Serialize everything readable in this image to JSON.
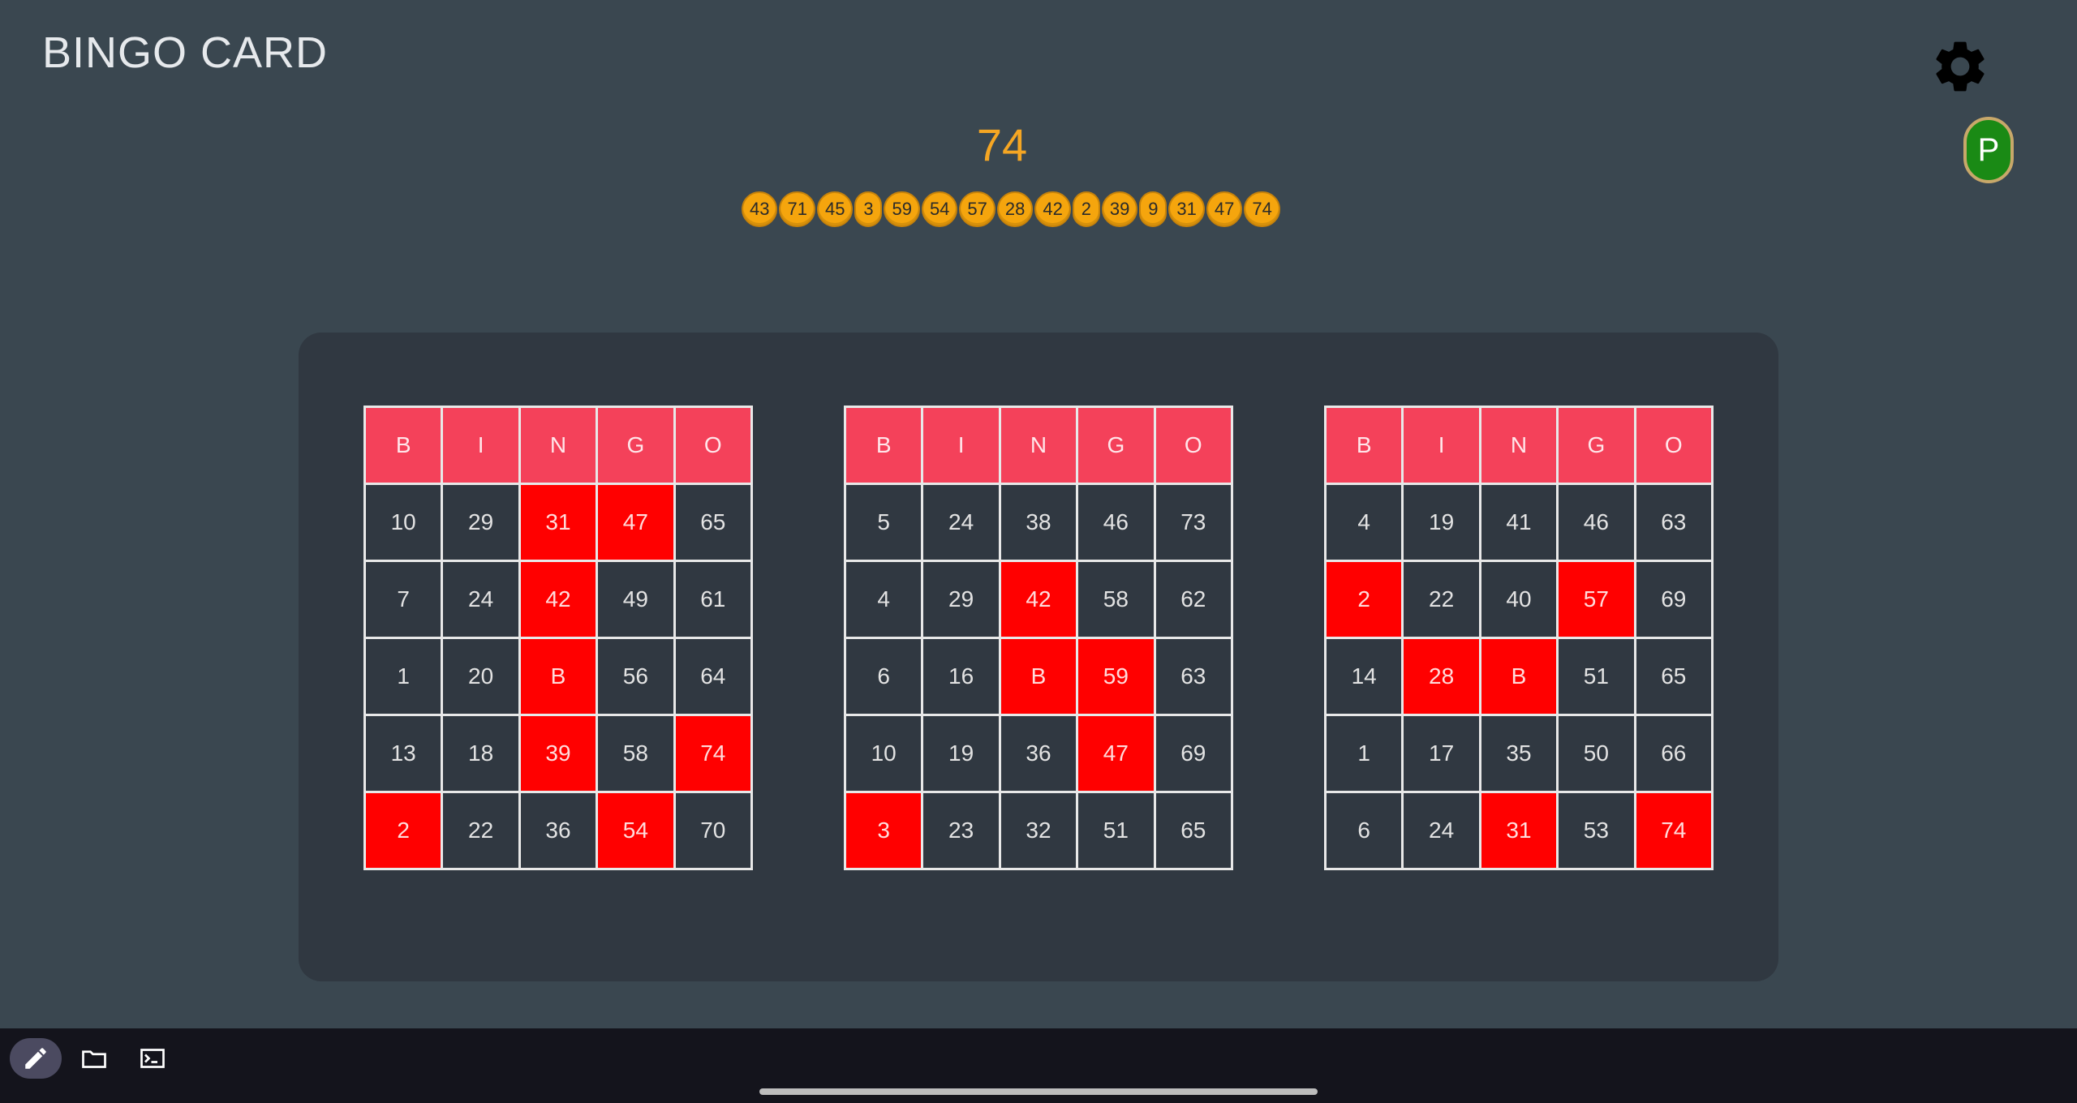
{
  "app": {
    "title": "BINGO CARD",
    "player_initial": "P",
    "current_number": "74",
    "called_numbers": [
      "43",
      "71",
      "45",
      "3",
      "59",
      "54",
      "57",
      "28",
      "42",
      "2",
      "39",
      "9",
      "31",
      "47",
      "74"
    ]
  },
  "colors": {
    "background": "#3a4750",
    "panel": "#303841",
    "header": "#f4415a",
    "marked": "#ff0000",
    "current_number": "#f5a623",
    "ball": "#f5a50d",
    "player_badge": "#1a8a15"
  },
  "icons": {
    "settings": "gear-icon",
    "edit": "pencil-icon",
    "files": "folder-icon",
    "terminal": "terminal-icon"
  },
  "cards": [
    {
      "header": [
        "B",
        "I",
        "N",
        "G",
        "O"
      ],
      "rows": [
        [
          {
            "v": "10",
            "m": false
          },
          {
            "v": "29",
            "m": false
          },
          {
            "v": "31",
            "m": true
          },
          {
            "v": "47",
            "m": true
          },
          {
            "v": "65",
            "m": false
          }
        ],
        [
          {
            "v": "7",
            "m": false
          },
          {
            "v": "24",
            "m": false
          },
          {
            "v": "42",
            "m": true
          },
          {
            "v": "49",
            "m": false
          },
          {
            "v": "61",
            "m": false
          }
        ],
        [
          {
            "v": "1",
            "m": false
          },
          {
            "v": "20",
            "m": false
          },
          {
            "v": "B",
            "m": true
          },
          {
            "v": "56",
            "m": false
          },
          {
            "v": "64",
            "m": false
          }
        ],
        [
          {
            "v": "13",
            "m": false
          },
          {
            "v": "18",
            "m": false
          },
          {
            "v": "39",
            "m": true
          },
          {
            "v": "58",
            "m": false
          },
          {
            "v": "74",
            "m": true
          }
        ],
        [
          {
            "v": "2",
            "m": true
          },
          {
            "v": "22",
            "m": false
          },
          {
            "v": "36",
            "m": false
          },
          {
            "v": "54",
            "m": true
          },
          {
            "v": "70",
            "m": false
          }
        ]
      ]
    },
    {
      "header": [
        "B",
        "I",
        "N",
        "G",
        "O"
      ],
      "rows": [
        [
          {
            "v": "5",
            "m": false
          },
          {
            "v": "24",
            "m": false
          },
          {
            "v": "38",
            "m": false
          },
          {
            "v": "46",
            "m": false
          },
          {
            "v": "73",
            "m": false
          }
        ],
        [
          {
            "v": "4",
            "m": false
          },
          {
            "v": "29",
            "m": false
          },
          {
            "v": "42",
            "m": true
          },
          {
            "v": "58",
            "m": false
          },
          {
            "v": "62",
            "m": false
          }
        ],
        [
          {
            "v": "6",
            "m": false
          },
          {
            "v": "16",
            "m": false
          },
          {
            "v": "B",
            "m": true
          },
          {
            "v": "59",
            "m": true
          },
          {
            "v": "63",
            "m": false
          }
        ],
        [
          {
            "v": "10",
            "m": false
          },
          {
            "v": "19",
            "m": false
          },
          {
            "v": "36",
            "m": false
          },
          {
            "v": "47",
            "m": true
          },
          {
            "v": "69",
            "m": false
          }
        ],
        [
          {
            "v": "3",
            "m": true
          },
          {
            "v": "23",
            "m": false
          },
          {
            "v": "32",
            "m": false
          },
          {
            "v": "51",
            "m": false
          },
          {
            "v": "65",
            "m": false
          }
        ]
      ]
    },
    {
      "header": [
        "B",
        "I",
        "N",
        "G",
        "O"
      ],
      "rows": [
        [
          {
            "v": "4",
            "m": false
          },
          {
            "v": "19",
            "m": false
          },
          {
            "v": "41",
            "m": false
          },
          {
            "v": "46",
            "m": false
          },
          {
            "v": "63",
            "m": false
          }
        ],
        [
          {
            "v": "2",
            "m": true
          },
          {
            "v": "22",
            "m": false
          },
          {
            "v": "40",
            "m": false
          },
          {
            "v": "57",
            "m": true
          },
          {
            "v": "69",
            "m": false
          }
        ],
        [
          {
            "v": "14",
            "m": false
          },
          {
            "v": "28",
            "m": true
          },
          {
            "v": "B",
            "m": true
          },
          {
            "v": "51",
            "m": false
          },
          {
            "v": "65",
            "m": false
          }
        ],
        [
          {
            "v": "1",
            "m": false
          },
          {
            "v": "17",
            "m": false
          },
          {
            "v": "35",
            "m": false
          },
          {
            "v": "50",
            "m": false
          },
          {
            "v": "66",
            "m": false
          }
        ],
        [
          {
            "v": "6",
            "m": false
          },
          {
            "v": "24",
            "m": false
          },
          {
            "v": "31",
            "m": true
          },
          {
            "v": "53",
            "m": false
          },
          {
            "v": "74",
            "m": true
          }
        ]
      ]
    }
  ]
}
